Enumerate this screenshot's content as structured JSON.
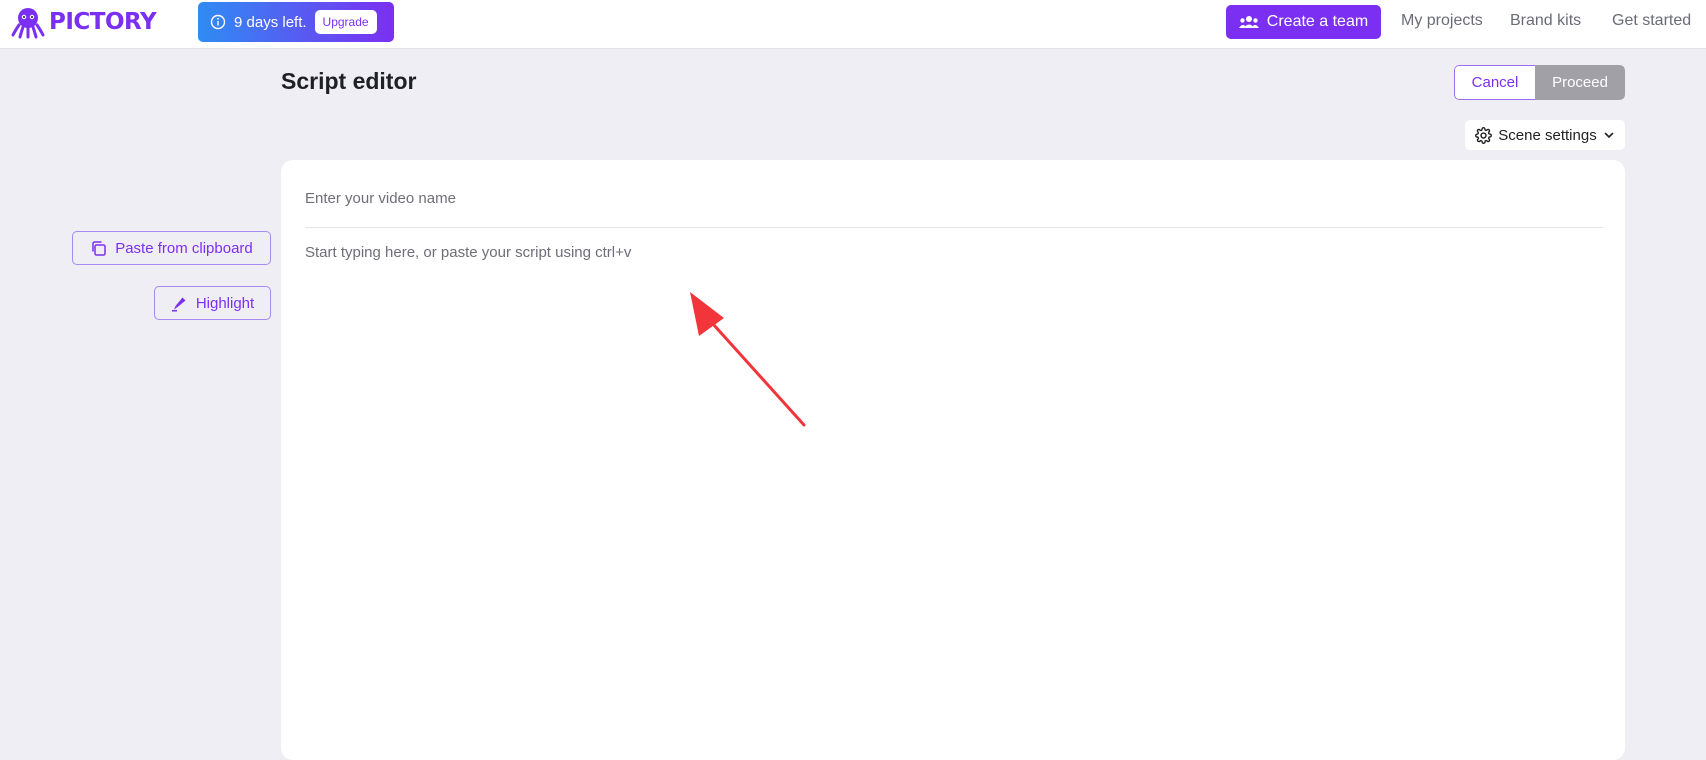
{
  "brand": {
    "name": "PICTORY",
    "logo_icon": "octopus-logo-icon",
    "accent": "#7b2ff2",
    "banner_start": "#2f8cf3"
  },
  "trial": {
    "icon": "info-icon",
    "text": "9 days left.",
    "upgrade_label": "Upgrade"
  },
  "nav": {
    "create_team_icon": "team-icon",
    "create_team_label": "Create a team",
    "my_projects": "My projects",
    "brand_kits": "Brand kits",
    "get_started": "Get started"
  },
  "header": {
    "title": "Script editor",
    "cancel_label": "Cancel",
    "proceed_label": "Proceed",
    "scene_settings_icon": "gear-icon",
    "scene_settings_label": "Scene settings",
    "scene_settings_chevron": "chevron-down-icon"
  },
  "tools": {
    "paste_icon": "copy-icon",
    "paste_label": "Paste from clipboard",
    "highlight_icon": "highlighter-icon",
    "highlight_label": "Highlight"
  },
  "editor": {
    "video_name_placeholder": "Enter your video name",
    "video_name_value": "",
    "script_placeholder": "Start typing here, or paste your script using ctrl+v",
    "script_value": ""
  },
  "annotation": {
    "color": "#f2353a"
  }
}
